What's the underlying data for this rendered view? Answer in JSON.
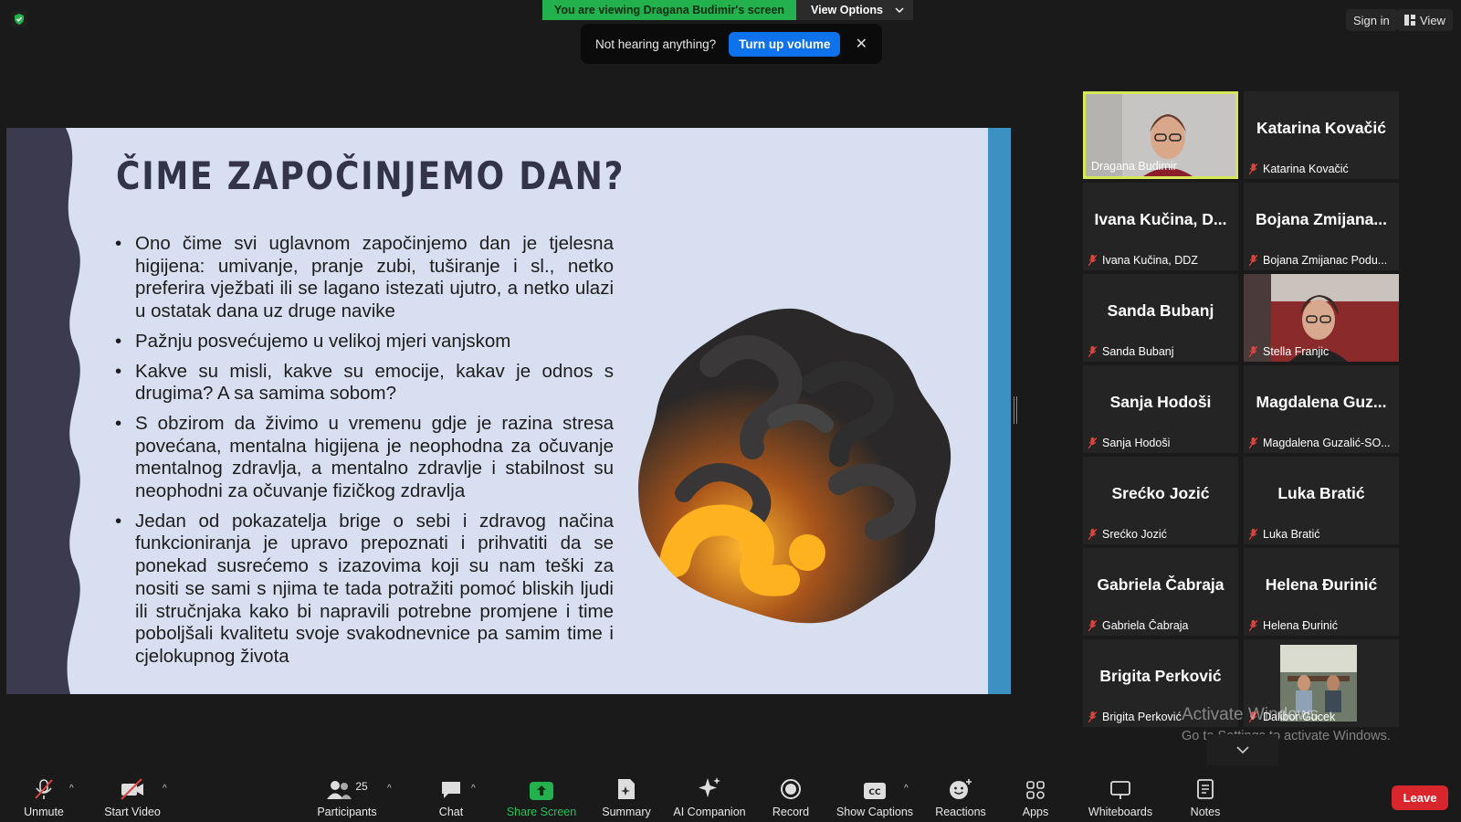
{
  "top": {
    "viewing_banner": "You are viewing Dragana Budimir's screen",
    "view_options": "View Options",
    "sign_in": "Sign in",
    "view": "View"
  },
  "toast": {
    "message": "Not hearing anything?",
    "button": "Turn up volume"
  },
  "slide": {
    "title": "ČIME ZAPOČINJEMO DAN?",
    "bullets": [
      "Ono čime svi uglavnom započinjemo dan je tjelesna higijena: umivanje, pranje zubi, tuširanje i sl., netko preferira vježbati ili se lagano istezati ujutro, a netko ulazi u ostatak dana uz druge navike",
      "Pažnju posvećujemo u velikoj mjeri vanjskom",
      "Kakve su misli, kakve su emocije, kakav je odnos s drugima? A sa samima sobom?",
      "S obzirom da živimo u vremenu gdje je razina stresa povećana, mentalna higijena je neophodna za očuvanje mentalnog zdravlja, a mentalno zdravlje i stabilnost su neophodni za očuvanje fizičkog zdravlja",
      "Jedan od pokazatelja brige o sebi i zdravog načina funkcioniranja je upravo prepoznati i prihvatiti da se ponekad susrećemo s izazovima koji su nam teški za nositi se sami s njima te tada potražiti pomoć bliskih ljudi ili stručnjaka kako bi napravili potrebne promjene i time poboljšali kvalitetu svoje svakodnevnice pa samim time i cjelokupnog života"
    ]
  },
  "participants": [
    {
      "big": "",
      "label": "Dragana Budimir",
      "video": true,
      "active": true
    },
    {
      "big": "Katarina Kovačić",
      "label": "Katarina Kovačić"
    },
    {
      "big": "Ivana Kučina, D...",
      "label": "Ivana Kučina, DDZ"
    },
    {
      "big": "Bojana Zmijana...",
      "label": "Bojana Zmijanac Podu..."
    },
    {
      "big": "Sanda Bubanj",
      "label": "Sanda Bubanj"
    },
    {
      "big": "",
      "label": "Stella Franjic",
      "video": true
    },
    {
      "big": "Sanja Hodoši",
      "label": "Sanja Hodoši"
    },
    {
      "big": "Magdalena Guz...",
      "label": "Magdalena Guzalić-SO..."
    },
    {
      "big": "Srećko Jozić",
      "label": "Srećko Jozić"
    },
    {
      "big": "Luka Bratić",
      "label": "Luka Bratić"
    },
    {
      "big": "Gabriela Čabraja",
      "label": "Gabriela Čabraja"
    },
    {
      "big": "Helena Đurinić",
      "label": "Helena Đurinić"
    },
    {
      "big": "Brigita Perković",
      "label": "Brigita Perković"
    },
    {
      "big": "",
      "label": "Dalibor Gucek",
      "video": true
    }
  ],
  "watermark": {
    "line1": "Activate Windows",
    "line2": "Go to Settings to activate Windows."
  },
  "toolbar": {
    "unmute": "Unmute",
    "start_video": "Start Video",
    "participants": "Participants",
    "participants_count": "25",
    "chat": "Chat",
    "share_screen": "Share Screen",
    "summary": "Summary",
    "ai_companion": "AI Companion",
    "record": "Record",
    "show_captions": "Show Captions",
    "reactions": "Reactions",
    "apps": "Apps",
    "whiteboards": "Whiteboards",
    "notes": "Notes",
    "leave": "Leave"
  },
  "colors": {
    "banner_green": "#23b14d",
    "volume_blue": "#0e72ed",
    "leave_red": "#d9262c",
    "active_border": "#d8e65a",
    "slide_bg": "#d8dff0",
    "slide_band": "#3b92c2"
  }
}
